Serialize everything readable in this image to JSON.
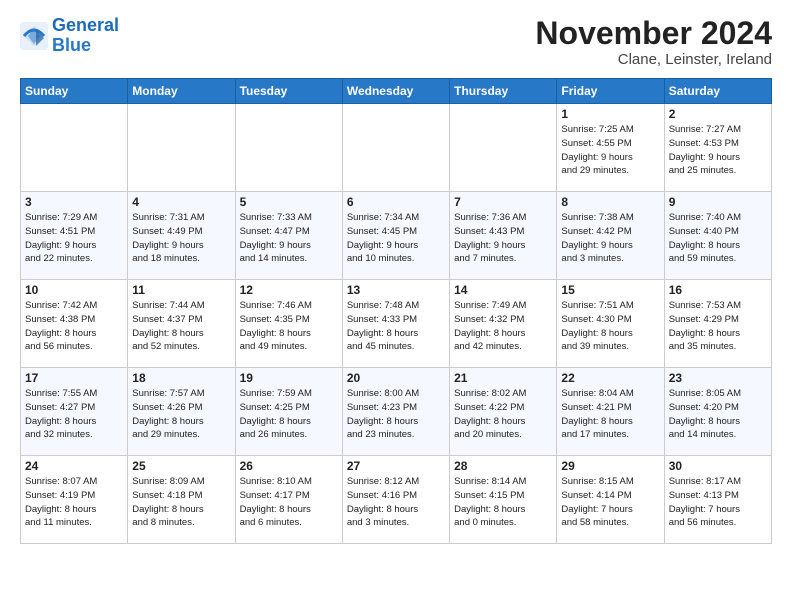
{
  "logo": {
    "line1": "General",
    "line2": "Blue"
  },
  "title": "November 2024",
  "subtitle": "Clane, Leinster, Ireland",
  "headers": [
    "Sunday",
    "Monday",
    "Tuesday",
    "Wednesday",
    "Thursday",
    "Friday",
    "Saturday"
  ],
  "weeks": [
    [
      {
        "day": "",
        "info": ""
      },
      {
        "day": "",
        "info": ""
      },
      {
        "day": "",
        "info": ""
      },
      {
        "day": "",
        "info": ""
      },
      {
        "day": "",
        "info": ""
      },
      {
        "day": "1",
        "info": "Sunrise: 7:25 AM\nSunset: 4:55 PM\nDaylight: 9 hours\nand 29 minutes."
      },
      {
        "day": "2",
        "info": "Sunrise: 7:27 AM\nSunset: 4:53 PM\nDaylight: 9 hours\nand 25 minutes."
      }
    ],
    [
      {
        "day": "3",
        "info": "Sunrise: 7:29 AM\nSunset: 4:51 PM\nDaylight: 9 hours\nand 22 minutes."
      },
      {
        "day": "4",
        "info": "Sunrise: 7:31 AM\nSunset: 4:49 PM\nDaylight: 9 hours\nand 18 minutes."
      },
      {
        "day": "5",
        "info": "Sunrise: 7:33 AM\nSunset: 4:47 PM\nDaylight: 9 hours\nand 14 minutes."
      },
      {
        "day": "6",
        "info": "Sunrise: 7:34 AM\nSunset: 4:45 PM\nDaylight: 9 hours\nand 10 minutes."
      },
      {
        "day": "7",
        "info": "Sunrise: 7:36 AM\nSunset: 4:43 PM\nDaylight: 9 hours\nand 7 minutes."
      },
      {
        "day": "8",
        "info": "Sunrise: 7:38 AM\nSunset: 4:42 PM\nDaylight: 9 hours\nand 3 minutes."
      },
      {
        "day": "9",
        "info": "Sunrise: 7:40 AM\nSunset: 4:40 PM\nDaylight: 8 hours\nand 59 minutes."
      }
    ],
    [
      {
        "day": "10",
        "info": "Sunrise: 7:42 AM\nSunset: 4:38 PM\nDaylight: 8 hours\nand 56 minutes."
      },
      {
        "day": "11",
        "info": "Sunrise: 7:44 AM\nSunset: 4:37 PM\nDaylight: 8 hours\nand 52 minutes."
      },
      {
        "day": "12",
        "info": "Sunrise: 7:46 AM\nSunset: 4:35 PM\nDaylight: 8 hours\nand 49 minutes."
      },
      {
        "day": "13",
        "info": "Sunrise: 7:48 AM\nSunset: 4:33 PM\nDaylight: 8 hours\nand 45 minutes."
      },
      {
        "day": "14",
        "info": "Sunrise: 7:49 AM\nSunset: 4:32 PM\nDaylight: 8 hours\nand 42 minutes."
      },
      {
        "day": "15",
        "info": "Sunrise: 7:51 AM\nSunset: 4:30 PM\nDaylight: 8 hours\nand 39 minutes."
      },
      {
        "day": "16",
        "info": "Sunrise: 7:53 AM\nSunset: 4:29 PM\nDaylight: 8 hours\nand 35 minutes."
      }
    ],
    [
      {
        "day": "17",
        "info": "Sunrise: 7:55 AM\nSunset: 4:27 PM\nDaylight: 8 hours\nand 32 minutes."
      },
      {
        "day": "18",
        "info": "Sunrise: 7:57 AM\nSunset: 4:26 PM\nDaylight: 8 hours\nand 29 minutes."
      },
      {
        "day": "19",
        "info": "Sunrise: 7:59 AM\nSunset: 4:25 PM\nDaylight: 8 hours\nand 26 minutes."
      },
      {
        "day": "20",
        "info": "Sunrise: 8:00 AM\nSunset: 4:23 PM\nDaylight: 8 hours\nand 23 minutes."
      },
      {
        "day": "21",
        "info": "Sunrise: 8:02 AM\nSunset: 4:22 PM\nDaylight: 8 hours\nand 20 minutes."
      },
      {
        "day": "22",
        "info": "Sunrise: 8:04 AM\nSunset: 4:21 PM\nDaylight: 8 hours\nand 17 minutes."
      },
      {
        "day": "23",
        "info": "Sunrise: 8:05 AM\nSunset: 4:20 PM\nDaylight: 8 hours\nand 14 minutes."
      }
    ],
    [
      {
        "day": "24",
        "info": "Sunrise: 8:07 AM\nSunset: 4:19 PM\nDaylight: 8 hours\nand 11 minutes."
      },
      {
        "day": "25",
        "info": "Sunrise: 8:09 AM\nSunset: 4:18 PM\nDaylight: 8 hours\nand 8 minutes."
      },
      {
        "day": "26",
        "info": "Sunrise: 8:10 AM\nSunset: 4:17 PM\nDaylight: 8 hours\nand 6 minutes."
      },
      {
        "day": "27",
        "info": "Sunrise: 8:12 AM\nSunset: 4:16 PM\nDaylight: 8 hours\nand 3 minutes."
      },
      {
        "day": "28",
        "info": "Sunrise: 8:14 AM\nSunset: 4:15 PM\nDaylight: 8 hours\nand 0 minutes."
      },
      {
        "day": "29",
        "info": "Sunrise: 8:15 AM\nSunset: 4:14 PM\nDaylight: 7 hours\nand 58 minutes."
      },
      {
        "day": "30",
        "info": "Sunrise: 8:17 AM\nSunset: 4:13 PM\nDaylight: 7 hours\nand 56 minutes."
      }
    ]
  ]
}
